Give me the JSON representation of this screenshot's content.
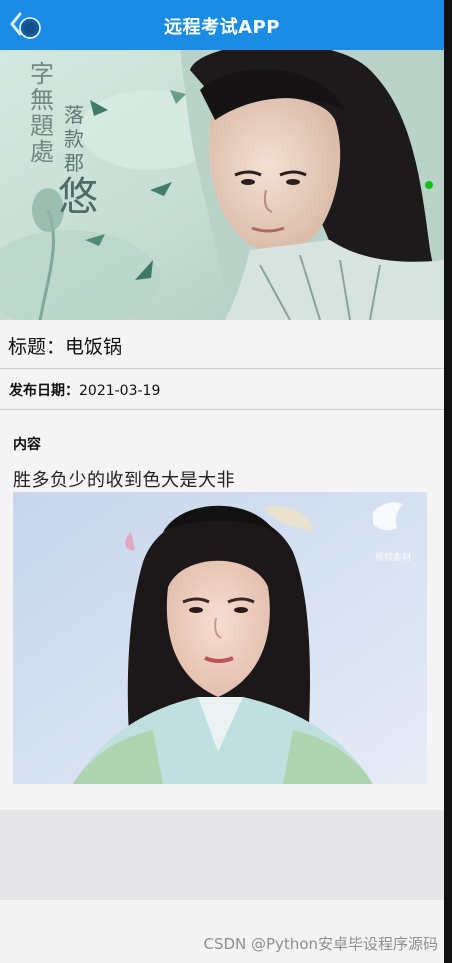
{
  "header": {
    "title": "远程考试APP"
  },
  "icons": {
    "back": "back-arrow-icon"
  },
  "colors": {
    "header_bg": "#1b8ce3",
    "indicator": "#14c11a"
  },
  "detail": {
    "title_label": "标题：",
    "title_value": "电饭锅",
    "date_label": "发布日期：",
    "date_value": "2021-03-19",
    "content_label": "内容",
    "content_text": "胜多负少的收到色大是大非"
  },
  "hero_image": {
    "calligraphy": [
      "字",
      "無",
      "題",
      "處",
      "落",
      "款",
      "郡",
      "悠"
    ]
  },
  "content_image": {
    "logo_text": "视频素材"
  },
  "watermark": "CSDN @Python安卓毕设程序源码"
}
